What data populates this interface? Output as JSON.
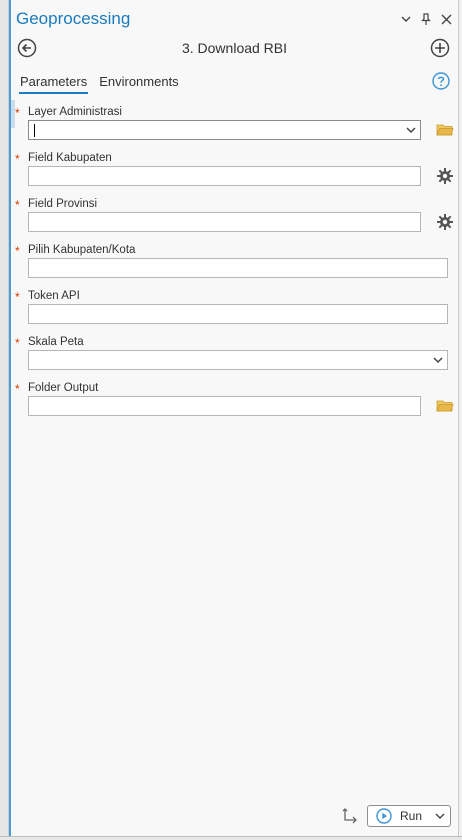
{
  "pane": {
    "title": "Geoprocessing"
  },
  "tool": {
    "title": "3. Download RBI"
  },
  "tabs": [
    {
      "label": "Parameters",
      "active": true
    },
    {
      "label": "Environments",
      "active": false
    }
  ],
  "params": [
    {
      "label": "Layer Administrasi",
      "value": "",
      "control": "dropdown",
      "side_icon": "folder-icon"
    },
    {
      "label": "Field Kabupaten",
      "value": "",
      "control": "text",
      "side_icon": "gear-icon"
    },
    {
      "label": "Field Provinsi",
      "value": "",
      "control": "text",
      "side_icon": "gear-icon"
    },
    {
      "label": "Pilih Kabupaten/Kota",
      "value": "",
      "control": "text",
      "side_icon": null
    },
    {
      "label": "Token API",
      "value": "",
      "control": "text",
      "side_icon": null
    },
    {
      "label": "Skala Peta",
      "value": "",
      "control": "dropdown",
      "side_icon": null
    },
    {
      "label": "Folder Output",
      "value": "",
      "control": "text",
      "side_icon": "folder-icon"
    }
  ],
  "required_marker": "*",
  "run": {
    "label": "Run"
  },
  "colors": {
    "accent": "#1a7bbf",
    "required": "#d83b01",
    "folder": "#e8b84a"
  }
}
